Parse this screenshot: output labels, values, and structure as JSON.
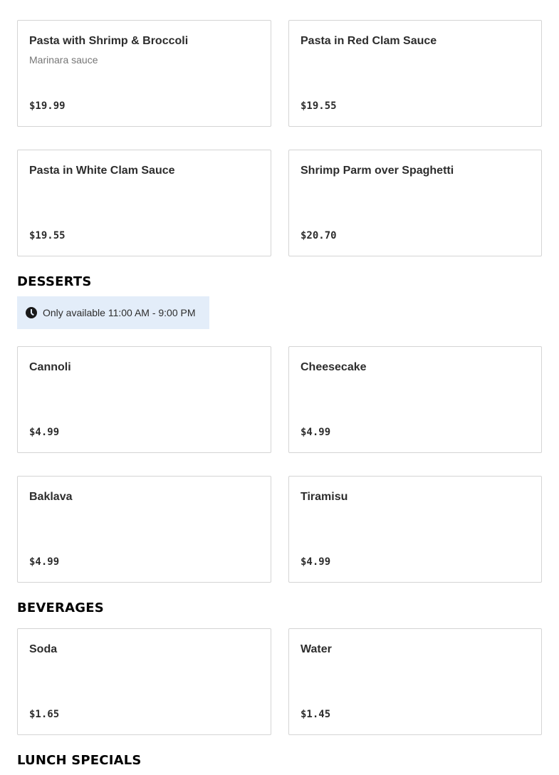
{
  "pasta_items": [
    {
      "name": "Pasta with Shrimp & Broccoli",
      "description": "Marinara sauce",
      "price": "$19.99"
    },
    {
      "name": "Pasta in Red Clam Sauce",
      "description": "",
      "price": "$19.55"
    },
    {
      "name": "Pasta in White Clam Sauce",
      "description": "",
      "price": "$19.55"
    },
    {
      "name": "Shrimp Parm over Spaghetti",
      "description": "",
      "price": "$20.70"
    }
  ],
  "desserts": {
    "title": "DESSERTS",
    "availability": "Only available 11:00 AM - 9:00 PM",
    "items": [
      {
        "name": "Cannoli",
        "price": "$4.99"
      },
      {
        "name": "Cheesecake",
        "price": "$4.99"
      },
      {
        "name": "Baklava",
        "price": "$4.99"
      },
      {
        "name": "Tiramisu",
        "price": "$4.99"
      }
    ]
  },
  "beverages": {
    "title": "BEVERAGES",
    "items": [
      {
        "name": "Soda",
        "price": "$1.65"
      },
      {
        "name": "Water",
        "price": "$1.45"
      }
    ]
  },
  "lunch_specials": {
    "title": "LUNCH SPECIALS"
  },
  "icons": {
    "availability_icon": "clock-icon"
  }
}
